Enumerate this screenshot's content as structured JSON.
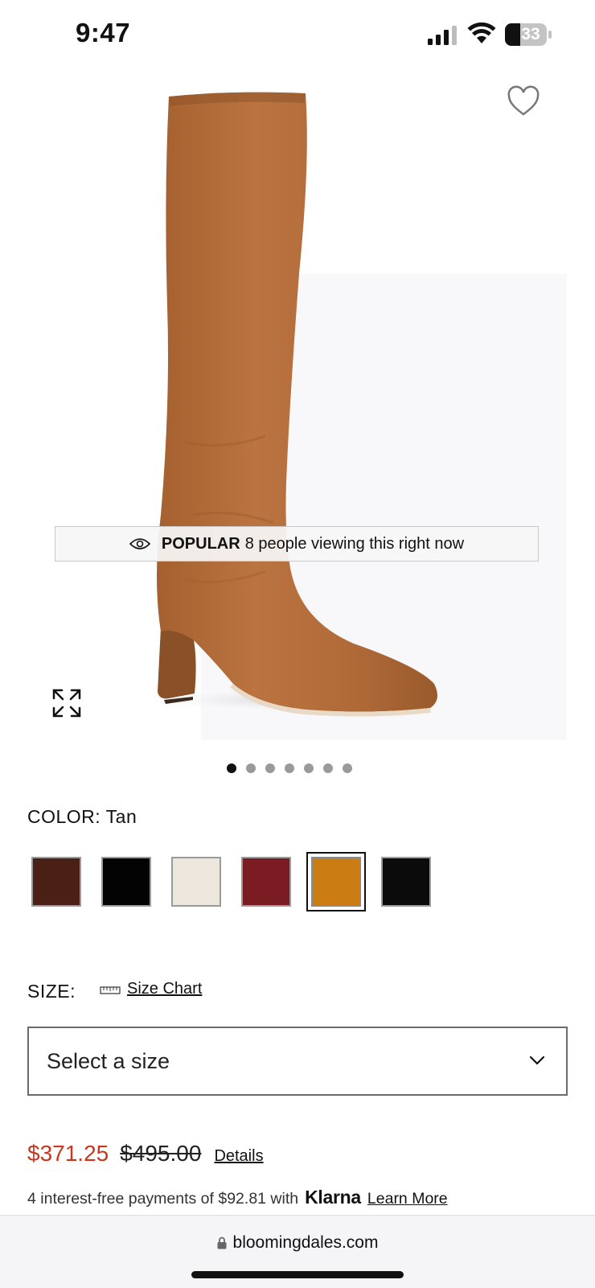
{
  "status_bar": {
    "time": "9:47",
    "battery": "33"
  },
  "product": {
    "popular_label": "POPULAR",
    "popular_text": "8 people viewing this right now",
    "image_count": 7,
    "active_image_index": 0
  },
  "color": {
    "label": "COLOR: Tan",
    "swatches": [
      {
        "name": "brown",
        "hex": "#4a1f16"
      },
      {
        "name": "black",
        "hex": "#030303"
      },
      {
        "name": "cream",
        "hex": "#ece6dc"
      },
      {
        "name": "burgundy",
        "hex": "#7a1c22"
      },
      {
        "name": "tan",
        "hex": "#cb7c12",
        "selected": true
      },
      {
        "name": "black-suede",
        "hex": "#0b0b0b"
      }
    ]
  },
  "size": {
    "label": "SIZE:",
    "chart_link": "Size Chart",
    "select_placeholder": "Select a size"
  },
  "price": {
    "sale": "$371.25",
    "original": "$495.00",
    "details_link": "Details"
  },
  "klarna": {
    "text": "4 interest-free payments of $92.81 with",
    "logo": "Klarna",
    "learn_more": "Learn More"
  },
  "browser": {
    "url": "bloomingdales.com"
  },
  "colors": {
    "sale_red": "#c9371e",
    "boot_tan": "#b46f3c"
  }
}
